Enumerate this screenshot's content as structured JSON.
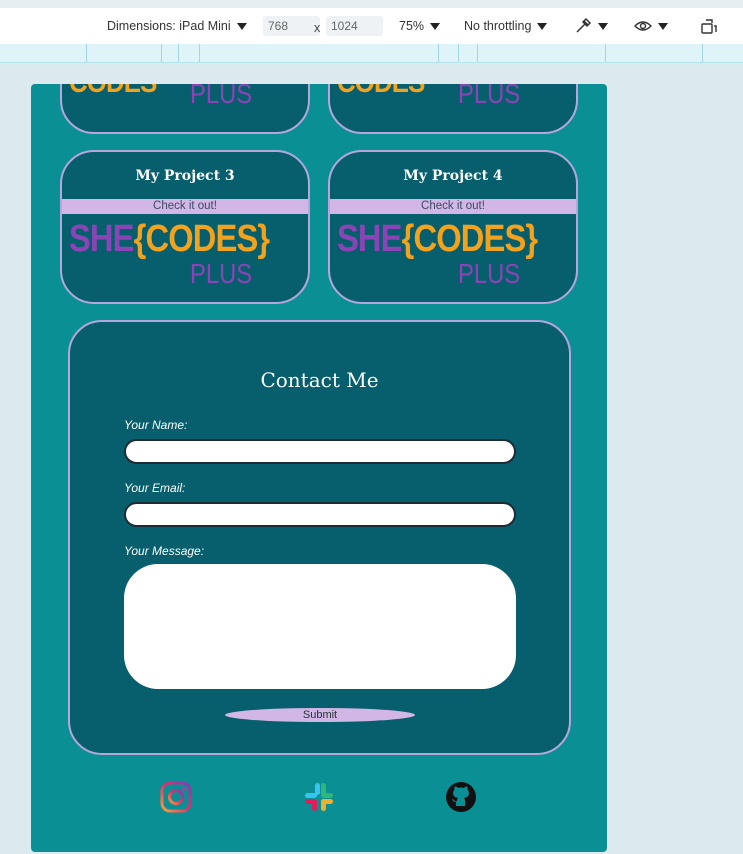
{
  "devtools": {
    "dimensions_label": "Dimensions: iPad Mini",
    "width_value": "768",
    "separator": "x",
    "height_value": "1024",
    "zoom": "75%",
    "throttling": "No throttling"
  },
  "projects": [
    {
      "title": "My Project 3",
      "link": "Check it out!",
      "logo_she": "SHE",
      "logo_codes": "{CODES}",
      "logo_plus": "PLUS"
    },
    {
      "title": "My Project 4",
      "link": "Check it out!",
      "logo_she": "SHE",
      "logo_codes": "{CODES}",
      "logo_plus": "PLUS"
    }
  ],
  "partial_logos": {
    "codes": "CODES",
    "plus": "PLUS"
  },
  "contact": {
    "title": "Contact Me",
    "name_label": "Your Name:",
    "email_label": "Your Email:",
    "message_label": "Your Message:",
    "submit": "Submit"
  },
  "social": [
    "instagram-icon",
    "slack-icon",
    "github-icon"
  ],
  "colors": {
    "page_bg": "#0a8f94",
    "card_bg": "#075f6d",
    "card_border": "#b6a7db",
    "link_bg": "#d2b7e6",
    "logo_purple": "#8a44b5",
    "logo_orange": "#f3a21d"
  }
}
